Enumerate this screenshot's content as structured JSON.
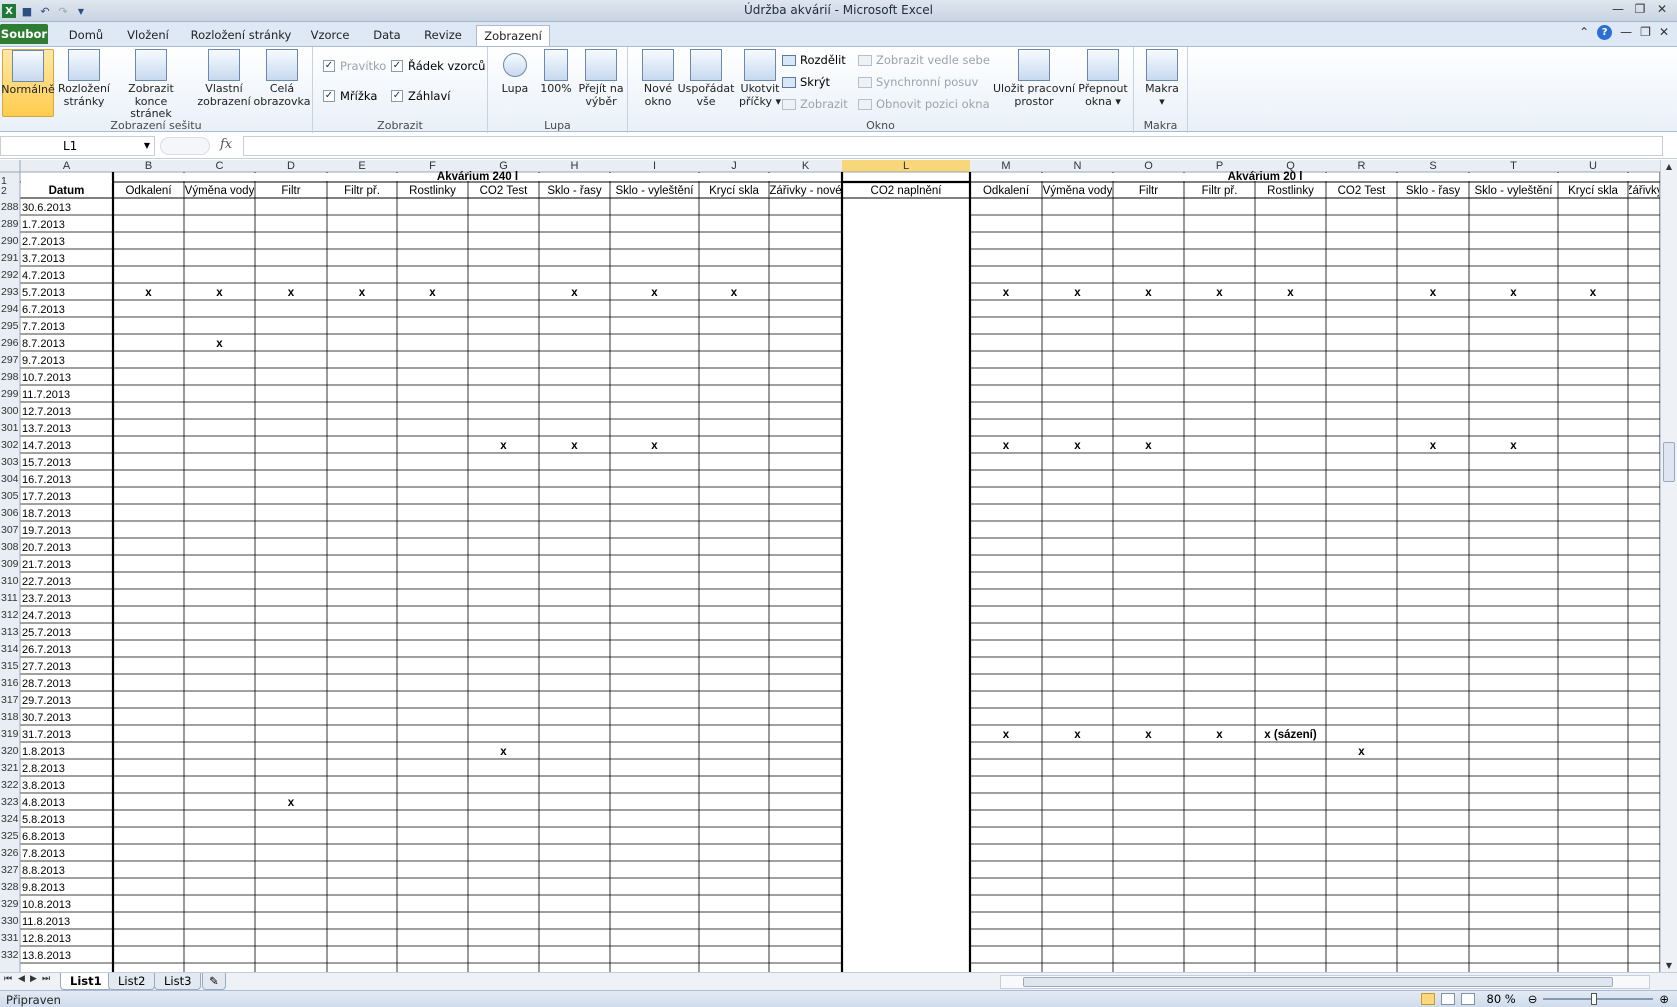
{
  "window": {
    "title": "Údržba akvárií - Microsoft Excel"
  },
  "ribbon_tabs": [
    "Soubor",
    "Domů",
    "Vložení",
    "Rozložení stránky",
    "Vzorce",
    "Data",
    "Revize",
    "Zobrazení"
  ],
  "active_tab": "Zobrazení",
  "groups": {
    "workbook_views": {
      "label": "Zobrazení sešitu",
      "buttons": [
        {
          "line1": "Normálně",
          "line2": ""
        },
        {
          "line1": "Rozložení",
          "line2": "stránky"
        },
        {
          "line1": "Zobrazit",
          "line2": "konce stránek"
        },
        {
          "line1": "Vlastní",
          "line2": "zobrazení"
        },
        {
          "line1": "Celá",
          "line2": "obrazovka"
        }
      ]
    },
    "show": {
      "label": "Zobrazit",
      "ruler": "Pravítko",
      "gridlines": "Mřížka",
      "formula_bar": "Řádek vzorců",
      "headings": "Záhlaví"
    },
    "zoom": {
      "label": "Lupa",
      "buttons": [
        {
          "line1": "Lupa",
          "line2": ""
        },
        {
          "line1": "100%",
          "line2": ""
        },
        {
          "line1": "Přejít na",
          "line2": "výběr"
        }
      ]
    },
    "window": {
      "label": "Okno",
      "buttons": [
        {
          "line1": "Nové",
          "line2": "okno"
        },
        {
          "line1": "Uspořádat",
          "line2": "vše"
        },
        {
          "line1": "Ukotvit",
          "line2": "příčky ▾"
        }
      ],
      "split": "Rozdělit",
      "hide": "Skrýt",
      "unhide": "Zobrazit",
      "side_by_side": "Zobrazit vedle sebe",
      "sync_scroll": "Synchronní posuv",
      "reset_position": "Obnovit pozici okna",
      "save_workspace": {
        "line1": "Uložit pracovní",
        "line2": "prostor"
      },
      "switch_windows": {
        "line1": "Přepnout",
        "line2": "okna ▾"
      }
    },
    "macros": {
      "label": "Makra",
      "button": "Makra"
    }
  },
  "formula_bar": {
    "name_box": "L1",
    "fx": "fx",
    "value": ""
  },
  "sheet": {
    "columns": [
      "A",
      "B",
      "C",
      "D",
      "E",
      "F",
      "G",
      "H",
      "I",
      "J",
      "K",
      "L",
      "M",
      "N",
      "O",
      "P",
      "Q",
      "R",
      "S",
      "T",
      "U",
      ""
    ],
    "selected_column": "L",
    "group1_title": "Akvárium 240 l",
    "group2_title": "Akvárium 20 l",
    "date_header": "Datum",
    "headers": [
      "Odkalení",
      "Výměna vody",
      "Filtr",
      "Filtr př.",
      "Rostlinky",
      "CO2 Test",
      "Sklo - řasy",
      "Sklo - vyleštění",
      "Krycí skla",
      "Zářivky - nové",
      "CO2 naplnění",
      "Odkalení",
      "Výměna vody",
      "Filtr",
      "Filtr př.",
      "Rostlinky",
      "CO2 Test",
      "Sklo - řasy",
      "Sklo - vyleštění",
      "Krycí skla",
      "Zářivky"
    ],
    "rows": [
      {
        "n": "288",
        "date": "30.6.2013",
        "marks": {}
      },
      {
        "n": "289",
        "date": "1.7.2013",
        "marks": {}
      },
      {
        "n": "290",
        "date": "2.7.2013",
        "marks": {}
      },
      {
        "n": "291",
        "date": "3.7.2013",
        "marks": {}
      },
      {
        "n": "292",
        "date": "4.7.2013",
        "marks": {}
      },
      {
        "n": "293",
        "date": "5.7.2013",
        "marks": {
          "B": "x",
          "C": "x",
          "D": "x",
          "E": "x",
          "F": "x",
          "H": "x",
          "I": "x",
          "J": "x",
          "M": "x",
          "N": "x",
          "O": "x",
          "P": "x",
          "Q": "x",
          "S": "x",
          "T": "x",
          "U": "x"
        }
      },
      {
        "n": "294",
        "date": "6.7.2013",
        "marks": {}
      },
      {
        "n": "295",
        "date": "7.7.2013",
        "marks": {}
      },
      {
        "n": "296",
        "date": "8.7.2013",
        "marks": {
          "C": "x"
        }
      },
      {
        "n": "297",
        "date": "9.7.2013",
        "marks": {}
      },
      {
        "n": "298",
        "date": "10.7.2013",
        "marks": {}
      },
      {
        "n": "299",
        "date": "11.7.2013",
        "marks": {}
      },
      {
        "n": "300",
        "date": "12.7.2013",
        "marks": {}
      },
      {
        "n": "301",
        "date": "13.7.2013",
        "marks": {}
      },
      {
        "n": "302",
        "date": "14.7.2013",
        "marks": {
          "G": "x",
          "H": "x",
          "I": "x",
          "M": "x",
          "N": "x",
          "O": "x",
          "S": "x",
          "T": "x"
        }
      },
      {
        "n": "303",
        "date": "15.7.2013",
        "marks": {}
      },
      {
        "n": "304",
        "date": "16.7.2013",
        "marks": {}
      },
      {
        "n": "305",
        "date": "17.7.2013",
        "marks": {}
      },
      {
        "n": "306",
        "date": "18.7.2013",
        "marks": {}
      },
      {
        "n": "307",
        "date": "19.7.2013",
        "marks": {}
      },
      {
        "n": "308",
        "date": "20.7.2013",
        "marks": {}
      },
      {
        "n": "309",
        "date": "21.7.2013",
        "marks": {}
      },
      {
        "n": "310",
        "date": "22.7.2013",
        "marks": {}
      },
      {
        "n": "311",
        "date": "23.7.2013",
        "marks": {}
      },
      {
        "n": "312",
        "date": "24.7.2013",
        "marks": {}
      },
      {
        "n": "313",
        "date": "25.7.2013",
        "marks": {}
      },
      {
        "n": "314",
        "date": "26.7.2013",
        "marks": {}
      },
      {
        "n": "315",
        "date": "27.7.2013",
        "marks": {}
      },
      {
        "n": "316",
        "date": "28.7.2013",
        "marks": {}
      },
      {
        "n": "317",
        "date": "29.7.2013",
        "marks": {}
      },
      {
        "n": "318",
        "date": "30.7.2013",
        "marks": {}
      },
      {
        "n": "319",
        "date": "31.7.2013",
        "marks": {
          "M": "x",
          "N": "x",
          "O": "x",
          "P": "x",
          "Q": "x (sázení)"
        }
      },
      {
        "n": "320",
        "date": "1.8.2013",
        "marks": {
          "G": "x",
          "R": "x"
        }
      },
      {
        "n": "321",
        "date": "2.8.2013",
        "marks": {}
      },
      {
        "n": "322",
        "date": "3.8.2013",
        "marks": {}
      },
      {
        "n": "323",
        "date": "4.8.2013",
        "marks": {
          "D": "x"
        }
      },
      {
        "n": "324",
        "date": "5.8.2013",
        "marks": {}
      },
      {
        "n": "325",
        "date": "6.8.2013",
        "marks": {}
      },
      {
        "n": "326",
        "date": "7.8.2013",
        "marks": {}
      },
      {
        "n": "327",
        "date": "8.8.2013",
        "marks": {}
      },
      {
        "n": "328",
        "date": "9.8.2013",
        "marks": {}
      },
      {
        "n": "329",
        "date": "10.8.2013",
        "marks": {}
      },
      {
        "n": "330",
        "date": "11.8.2013",
        "marks": {}
      },
      {
        "n": "331",
        "date": "12.8.2013",
        "marks": {}
      },
      {
        "n": "332",
        "date": "13.8.2013",
        "marks": {}
      }
    ]
  },
  "sheet_tabs": [
    "List1",
    "List2",
    "List3"
  ],
  "active_sheet": "List1",
  "status": {
    "ready": "Připraven",
    "zoom": "80 %"
  },
  "colors": {
    "file_tab": "#2e7d32",
    "selected_header": "#f7d77a",
    "accent": "#2c6fd1"
  }
}
